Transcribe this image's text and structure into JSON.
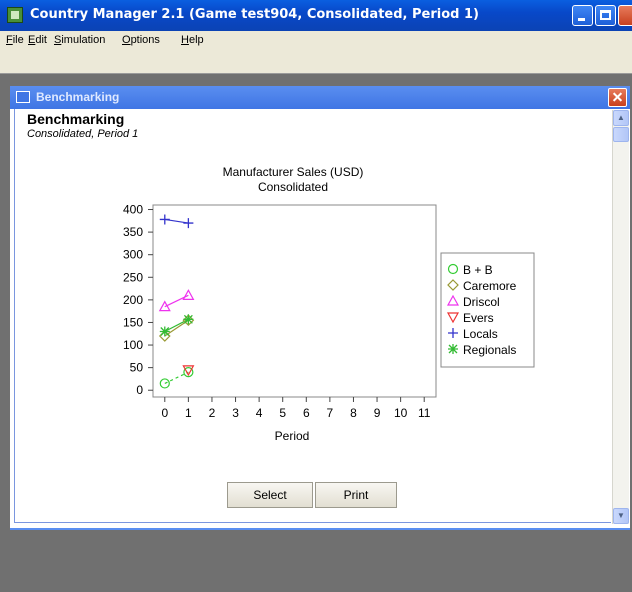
{
  "window": {
    "title": "Country Manager 2.1 (Game test904, Consolidated, Period 1)"
  },
  "menu": [
    {
      "label": "File",
      "key": "F",
      "rest": "ile"
    },
    {
      "label": "Edit",
      "key": "E",
      "rest": "dit"
    },
    {
      "label": "Simulation",
      "key": "S",
      "rest": "imulation"
    },
    {
      "label": "Options",
      "key": "O",
      "rest": "ptions"
    },
    {
      "label": "Help",
      "key": "H",
      "rest": "elp"
    }
  ],
  "child": {
    "title": "Benchmarking"
  },
  "report": {
    "heading": "Benchmarking",
    "subheading": "Consolidated, Period 1"
  },
  "buttons": {
    "select": "Select",
    "print": "Print"
  },
  "icons": [
    "app-icon",
    "minimize-icon",
    "maximize-icon",
    "close-icon",
    "window-icon",
    "scroll-up-icon",
    "scroll-down-icon"
  ],
  "chart_data": {
    "type": "line",
    "title": "Manufacturer Sales (USD)",
    "subtitle": "Consolidated",
    "xlabel": "Period",
    "ylabel": "",
    "x_ticks": [
      0,
      1,
      2,
      3,
      4,
      5,
      6,
      7,
      8,
      9,
      10,
      11
    ],
    "y_ticks": [
      0,
      50,
      100,
      150,
      200,
      250,
      300,
      350,
      400
    ],
    "xlim": [
      -0.5,
      11.5
    ],
    "ylim": [
      -15,
      410
    ],
    "legend_position": "right",
    "x": [
      0,
      1
    ],
    "series": [
      {
        "name": "B + B",
        "marker": "circle",
        "color": "#33cc33",
        "dashed": true,
        "values": [
          15,
          40
        ]
      },
      {
        "name": "Caremore",
        "marker": "diamond",
        "color": "#999933",
        "dashed": false,
        "values": [
          120,
          155
        ]
      },
      {
        "name": "Driscol",
        "marker": "triangle-up",
        "color": "#ee33ee",
        "dashed": false,
        "values": [
          185,
          210
        ]
      },
      {
        "name": "Evers",
        "marker": "triangle-down",
        "color": "#ee3333",
        "dashed": false,
        "values": [
          null,
          45
        ]
      },
      {
        "name": "Locals",
        "marker": "plus",
        "color": "#3333cc",
        "dashed": false,
        "values": [
          378,
          370
        ]
      },
      {
        "name": "Regionals",
        "marker": "star",
        "color": "#33bb33",
        "dashed": false,
        "values": [
          130,
          157
        ]
      }
    ]
  }
}
